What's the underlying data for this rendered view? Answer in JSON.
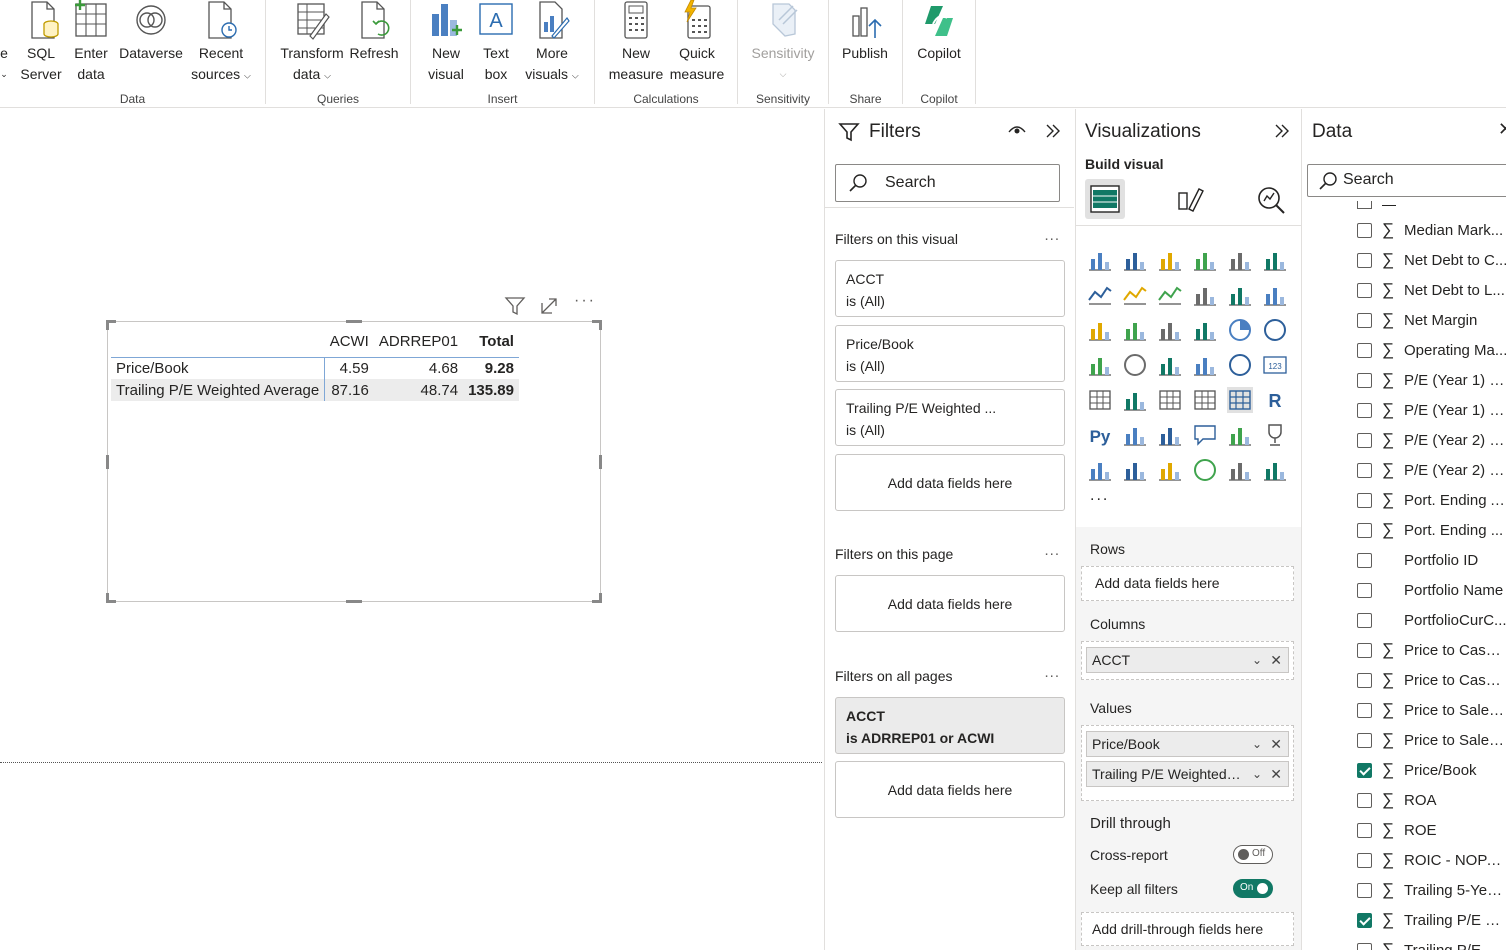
{
  "ribbon": {
    "groups": [
      {
        "label": "Data"
      },
      {
        "label": "Queries"
      },
      {
        "label": "Insert"
      },
      {
        "label": "Calculations"
      },
      {
        "label": "Sensitivity"
      },
      {
        "label": "Share"
      },
      {
        "label": "Copilot"
      }
    ],
    "buttons": {
      "partial": {
        "line1": "e",
        "caret": "⌄"
      },
      "sql_server": {
        "line1": "SQL",
        "line2": "Server"
      },
      "enter_data": {
        "line1": "Enter",
        "line2": "data"
      },
      "dataverse": {
        "line1": "Dataverse"
      },
      "recent_sources": {
        "line1": "Recent",
        "line2": "sources"
      },
      "transform_data": {
        "line1": "Transform",
        "line2": "data"
      },
      "refresh": {
        "line1": "Refresh"
      },
      "new_visual": {
        "line1": "New",
        "line2": "visual"
      },
      "text_box": {
        "line1": "Text",
        "line2": "box"
      },
      "more_visuals": {
        "line1": "More",
        "line2": "visuals"
      },
      "new_measure": {
        "line1": "New",
        "line2": "measure"
      },
      "quick_measure": {
        "line1": "Quick",
        "line2": "measure"
      },
      "sensitivity": {
        "line1": "Sensitivity"
      },
      "publish": {
        "line1": "Publish"
      },
      "copilot": {
        "line1": "Copilot"
      }
    }
  },
  "matrix": {
    "columns": [
      "ACWI",
      "ADRREP01",
      "Total"
    ],
    "rows": [
      {
        "label": "Price/Book",
        "values": [
          "4.59",
          "4.68",
          "9.28"
        ]
      },
      {
        "label": "Trailing P/E Weighted Average",
        "values": [
          "87.16",
          "48.74",
          "135.89"
        ]
      }
    ]
  },
  "filters": {
    "title": "Filters",
    "search_placeholder": "Search",
    "sections": {
      "visual": "Filters on this visual",
      "page": "Filters on this page",
      "all": "Filters on all pages"
    },
    "more": "...",
    "visual_cards": [
      {
        "name": "ACCT",
        "state": "is (All)"
      },
      {
        "name": "Price/Book",
        "state": "is (All)"
      },
      {
        "name": "Trailing P/E Weighted ...",
        "state": "is (All)"
      }
    ],
    "all_pages_card": {
      "name": "ACCT",
      "state": "is ADRREP01 or ACWI"
    },
    "add_fields": "Add data fields here"
  },
  "visualizations": {
    "title": "Visualizations",
    "subtitle": "Build visual",
    "more_dots": "...",
    "wells": {
      "rows": {
        "label": "Rows",
        "placeholder": "Add data fields here"
      },
      "columns": {
        "label": "Columns",
        "fields": [
          "ACCT"
        ]
      },
      "values": {
        "label": "Values",
        "fields": [
          "Price/Book",
          "Trailing P/E Weighted ..."
        ]
      }
    },
    "drill": {
      "title": "Drill through",
      "cross_report": {
        "label": "Cross-report",
        "state": "Off"
      },
      "keep_filters": {
        "label": "Keep all filters",
        "state": "On"
      },
      "add": "Add drill-through fields here"
    },
    "accent": "#117865"
  },
  "data_pane": {
    "title": "Data",
    "search_placeholder": "Search",
    "fields": [
      {
        "label": "Median Mark...",
        "sigma": true,
        "checked": false
      },
      {
        "label": "Net Debt to C...",
        "sigma": true,
        "checked": false
      },
      {
        "label": "Net Debt to L...",
        "sigma": true,
        "checked": false
      },
      {
        "label": "Net Margin",
        "sigma": true,
        "checked": false
      },
      {
        "label": "Operating Ma...",
        "sigma": true,
        "checked": false
      },
      {
        "label": "P/E (Year 1) W...",
        "sigma": true,
        "checked": false
      },
      {
        "label": "P/E (Year 1) W...",
        "sigma": true,
        "checked": false
      },
      {
        "label": "P/E (Year 2) W...",
        "sigma": true,
        "checked": false
      },
      {
        "label": "P/E (Year 2) W...",
        "sigma": true,
        "checked": false
      },
      {
        "label": "Port. Ending A...",
        "sigma": true,
        "checked": false
      },
      {
        "label": "Port. Ending ...",
        "sigma": true,
        "checked": false
      },
      {
        "label": "Portfolio ID",
        "sigma": false,
        "checked": false
      },
      {
        "label": "Portfolio Name",
        "sigma": false,
        "checked": false
      },
      {
        "label": "PortfolioCurC...",
        "sigma": false,
        "checked": false
      },
      {
        "label": "Price to Cash ...",
        "sigma": true,
        "checked": false
      },
      {
        "label": "Price to Cash ...",
        "sigma": true,
        "checked": false
      },
      {
        "label": "Price to Sales ...",
        "sigma": true,
        "checked": false
      },
      {
        "label": "Price to Sales ...",
        "sigma": true,
        "checked": false
      },
      {
        "label": "Price/Book",
        "sigma": true,
        "checked": true
      },
      {
        "label": "ROA",
        "sigma": true,
        "checked": false
      },
      {
        "label": "ROE",
        "sigma": true,
        "checked": false
      },
      {
        "label": "ROIC - NOPAT...",
        "sigma": true,
        "checked": false
      },
      {
        "label": "Trailing 5-Year...",
        "sigma": true,
        "checked": false
      },
      {
        "label": "Trailing P/E W...",
        "sigma": true,
        "checked": true
      },
      {
        "label": "Trailing P/E W...",
        "sigma": true,
        "checked": false
      }
    ]
  }
}
